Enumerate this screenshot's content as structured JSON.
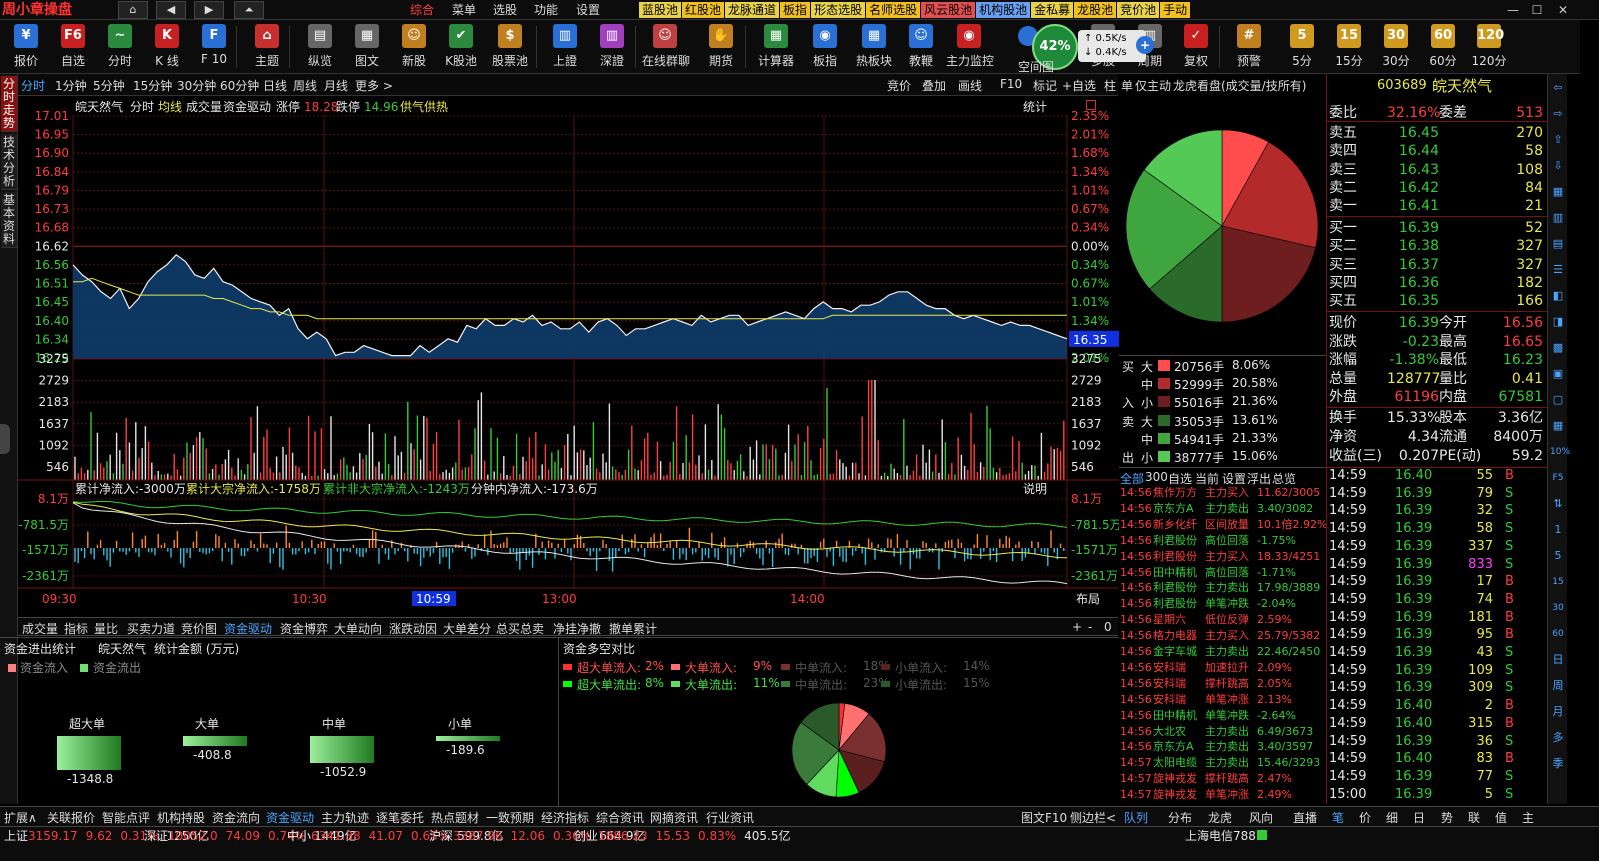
{
  "app": {
    "logo": "周小章操盘"
  },
  "nav": {
    "home": "⌂",
    "back": "◀",
    "fwd": "▶",
    "up": "⏶"
  },
  "menu": [
    {
      "label": "综合",
      "active": true
    },
    {
      "label": "菜单"
    },
    {
      "label": "选股"
    },
    {
      "label": "功能"
    },
    {
      "label": "设置"
    }
  ],
  "pools": [
    {
      "label": "蓝股池",
      "bg": "#e8d24a"
    },
    {
      "label": "红股池",
      "bg": "#f0c020"
    },
    {
      "label": "龙脉通道",
      "bg": "#e8d24a"
    },
    {
      "label": "板指",
      "bg": "#f0c020"
    },
    {
      "label": "形态选股",
      "bg": "#e8d24a"
    },
    {
      "label": "名师选股",
      "bg": "#f0c020"
    },
    {
      "label": "风云股池",
      "bg": "#e05050"
    },
    {
      "label": "机构股池",
      "bg": "#6aa0f0"
    },
    {
      "label": "金私募",
      "bg": "#e8d24a"
    },
    {
      "label": "龙股池",
      "bg": "#f0c020"
    },
    {
      "label": "竞价池",
      "bg": "#e8d24a"
    },
    {
      "label": "手动",
      "bg": "#f0c020"
    }
  ],
  "toolbar": [
    {
      "label": "报价",
      "icon": "¥",
      "color": "#2a6fd6"
    },
    {
      "label": "自选",
      "icon": "F6",
      "color": "#c82020"
    },
    {
      "label": "分时",
      "icon": "~",
      "color": "#2b8a3e"
    },
    {
      "label": "K 线",
      "icon": "K",
      "color": "#c82020"
    },
    {
      "label": "F 10",
      "icon": "F",
      "color": "#2a6fd6"
    },
    {
      "label": "主题",
      "icon": "⌂",
      "color": "#c83030"
    },
    {
      "label": "纵览",
      "icon": "▤",
      "color": "#666"
    },
    {
      "label": "图文",
      "icon": "▦",
      "color": "#666"
    },
    {
      "label": "新股",
      "icon": "☺",
      "color": "#c08020"
    },
    {
      "label": "K股池",
      "icon": "✔",
      "color": "#2b8a3e"
    },
    {
      "label": "股票池",
      "icon": "$",
      "color": "#c08020"
    },
    {
      "label": "上證",
      "icon": "▥",
      "color": "#2a6fd6"
    },
    {
      "label": "深證",
      "icon": "▥",
      "color": "#a040c0"
    },
    {
      "label": "在线群聊",
      "icon": "☺",
      "color": "#c04040"
    },
    {
      "label": "期货",
      "icon": "✋",
      "color": "#c08020"
    },
    {
      "label": "计算器",
      "icon": "▦",
      "color": "#2b8a3e"
    },
    {
      "label": "板指",
      "icon": "◉",
      "color": "#2a6fd6"
    },
    {
      "label": "热板块",
      "icon": "▦",
      "color": "#2a6fd6"
    },
    {
      "label": "教鞭",
      "icon": "☺",
      "color": "#2a6fd6"
    },
    {
      "label": "主力监控",
      "icon": "◉",
      "color": "#c82020"
    },
    {
      "label": "空间图",
      "icon": "◌",
      "color": "#2a6fd6"
    },
    {
      "label": "多股",
      "icon": "▦",
      "color": "#666"
    },
    {
      "label": "周期",
      "icon": "▥",
      "color": "#666"
    },
    {
      "label": "复权",
      "icon": "✓",
      "color": "#c82020"
    },
    {
      "label": "预警",
      "icon": "#",
      "color": "#c08020"
    },
    {
      "label": "5分",
      "icon": "5",
      "color": "#d09a20"
    },
    {
      "label": "15分",
      "icon": "15",
      "color": "#d09a20"
    },
    {
      "label": "30分",
      "icon": "30",
      "color": "#d09a20"
    },
    {
      "label": "60分",
      "icon": "60",
      "color": "#d09a20"
    },
    {
      "label": "120分",
      "icon": "120",
      "color": "#d09a20"
    }
  ],
  "speed": {
    "pct": "42%",
    "up": "0.5K/s",
    "down": "0.4K/s"
  },
  "leftTabs": [
    {
      "label": "分时走势",
      "on": true
    },
    {
      "label": "技术分析"
    },
    {
      "label": "基本资料"
    }
  ],
  "periodTabs": [
    "分时",
    "1分钟",
    "5分钟",
    "15分钟",
    "30分钟",
    "60分钟",
    "日线",
    "周线",
    "月线",
    "更多 >"
  ],
  "rightTabs": [
    "竞价",
    "叠加",
    "画线",
    "F10",
    "标记",
    "+自选",
    "柱",
    "单",
    "仅主动",
    "龙虎看盘(成交量/技所有)"
  ],
  "chartHeader": {
    "stock": "皖天然气",
    "mode": "分时",
    "avg": "均线",
    "vol": "成交量",
    "fund": "资金驱动",
    "limitUpLbl": "涨停",
    "limitUp": "18.28",
    "limitDnLbl": "跌停",
    "limitDn": "14.96",
    "supply": "供气供热",
    "stat": "统计"
  },
  "lowerHeader": {
    "a": "累计净流入:-3000万",
    "b": "累计大宗净流入:-1758万",
    "c": "累计非大宗净流入:-1243万",
    "d": "分钟内净流入:-173.6万",
    "help": "说明"
  },
  "chart_data": {
    "type": "line",
    "price": {
      "yTicks": [
        "17.01",
        "16.95",
        "16.90",
        "16.84",
        "16.79",
        "16.73",
        "16.68",
        "16.62",
        "16.56",
        "16.51",
        "16.45",
        "16.40",
        "16.34",
        "16.29"
      ],
      "pctTicks": [
        "2.35%",
        "2.01%",
        "1.68%",
        "1.34%",
        "1.01%",
        "0.67%",
        "0.34%",
        "0.00%",
        "0.34%",
        "0.67%",
        "1.01%",
        "1.34%",
        "1.68%",
        "2.01%"
      ],
      "last": "16.35",
      "values": [
        16.57,
        16.54,
        16.52,
        16.49,
        16.47,
        16.5,
        16.44,
        16.47,
        16.52,
        16.55,
        16.57,
        16.6,
        16.58,
        16.54,
        16.53,
        16.56,
        16.52,
        16.51,
        16.49,
        16.47,
        16.46,
        16.45,
        16.42,
        16.44,
        16.38,
        16.35,
        16.37,
        16.35,
        16.3,
        16.31,
        16.31,
        16.33,
        16.32,
        16.31,
        16.3,
        16.3,
        16.3,
        16.33,
        16.31,
        16.33,
        16.35,
        16.34,
        16.39,
        16.38,
        16.41,
        16.39,
        16.39,
        16.41,
        16.4,
        16.42,
        16.39,
        16.4,
        16.38,
        16.38,
        16.4,
        16.37,
        16.4,
        16.41,
        16.39,
        16.36,
        16.38,
        16.38,
        16.39,
        16.4,
        16.41,
        16.4,
        16.39,
        16.42,
        16.4,
        16.41,
        16.42,
        16.42,
        16.39,
        16.4,
        16.41,
        16.42,
        16.43,
        16.42,
        16.41,
        16.44,
        16.46,
        16.44,
        16.44,
        16.43,
        16.45,
        16.45,
        16.46,
        16.48,
        16.49,
        16.49,
        16.47,
        16.45,
        16.44,
        16.44,
        16.42,
        16.41,
        16.42,
        16.41,
        16.4,
        16.39,
        16.4,
        16.39,
        16.39,
        16.38,
        16.37,
        16.36,
        16.35
      ],
      "avg": [
        16.52,
        16.52,
        16.53,
        16.52,
        16.51,
        16.5,
        16.49,
        16.48,
        16.48,
        16.48,
        16.48,
        16.48,
        16.48,
        16.48,
        16.48,
        16.47,
        16.47,
        16.46,
        16.45,
        16.44,
        16.44,
        16.43,
        16.43,
        16.42,
        16.42,
        16.42,
        16.41,
        16.41,
        16.41,
        16.41,
        16.41,
        16.41,
        16.41,
        16.41,
        16.41,
        16.41,
        16.41,
        16.41,
        16.41,
        16.41,
        16.41,
        16.41,
        16.41,
        16.41,
        16.41,
        16.41,
        16.41,
        16.41,
        16.41,
        16.41,
        16.41,
        16.41,
        16.41,
        16.41,
        16.41,
        16.41,
        16.41,
        16.41,
        16.41,
        16.41,
        16.41,
        16.41,
        16.41,
        16.41,
        16.41,
        16.41,
        16.41,
        16.41,
        16.41,
        16.41,
        16.41,
        16.41,
        16.41,
        16.41,
        16.41,
        16.41,
        16.41,
        16.41,
        16.41,
        16.41,
        16.41,
        16.42,
        16.42,
        16.42,
        16.42,
        16.42,
        16.42,
        16.42,
        16.42,
        16.42,
        16.42,
        16.42,
        16.42,
        16.42,
        16.42,
        16.42,
        16.42,
        16.42,
        16.42,
        16.42,
        16.42,
        16.42,
        16.42,
        16.42,
        16.42,
        16.42,
        16.42
      ]
    },
    "volume": {
      "yTicks": [
        "3275",
        "2729",
        "2183",
        "1637",
        "1092",
        "546"
      ]
    },
    "flow": {
      "yTicks": [
        "8.1万",
        "-781.5万",
        "-1571万",
        "-2361万"
      ]
    },
    "timeAxis": [
      "09:30",
      "10:30",
      "10:59",
      "13:00",
      "14:00"
    ]
  },
  "subTabs": [
    "成交量",
    "指标",
    "量比",
    "买卖力道",
    "竞价图",
    "资金驱动",
    "资金博弈",
    "大单动向",
    "涨跌动因",
    "大单差分",
    "总买总卖",
    "净挂净撤",
    "撤单累计"
  ],
  "subTabsActive": "资金驱动",
  "layoutBtn": "布局",
  "panelA": {
    "title": "资金进出统计",
    "stock": "皖天然气",
    "unit": "统计金额 (万元)",
    "inLbl": "资金流入",
    "outLbl": "资金流出",
    "bars": [
      {
        "name": "超大单",
        "value": "-1348.8",
        "fill": 1.0
      },
      {
        "name": "大单",
        "value": "-408.8",
        "fill": 0.3
      },
      {
        "name": "中单",
        "value": "-1052.9",
        "fill": 0.78
      },
      {
        "name": "小单",
        "value": "-189.6",
        "fill": 0.14
      }
    ]
  },
  "panelB": {
    "title": "资金多空对比",
    "legend": [
      {
        "label": "超大单流入:",
        "value": "2%",
        "color": "#ff3030"
      },
      {
        "label": "大单流入:",
        "value": "9%",
        "color": "#ff7070"
      },
      {
        "label": "中单流入:",
        "value": "18%",
        "color": "#7a3030"
      },
      {
        "label": "小单流入:",
        "value": "14%",
        "color": "#5a2020"
      },
      {
        "label": "超大单流出:",
        "value": "8%",
        "color": "#00ff00"
      },
      {
        "label": "大单流出:",
        "value": "11%",
        "color": "#5fdc5f"
      },
      {
        "label": "中单流出:",
        "value": "23%",
        "color": "#3a7a3a"
      },
      {
        "label": "小单流出:",
        "value": "15%",
        "color": "#2a5a2a"
      }
    ]
  },
  "bigPie": {
    "fractions": [
      0.0806,
      0.2058,
      0.2136,
      0.1361,
      0.2133,
      0.1506
    ],
    "colors": [
      "#ff4d4d",
      "#b22a2a",
      "#6e1e1e",
      "#2a6a2a",
      "#3fa63f",
      "#55c955"
    ]
  },
  "orderStats": [
    {
      "side": "买",
      "size": "大",
      "hand": "20756手",
      "pct": "8.06%",
      "color": "#ff4d4d"
    },
    {
      "side": "",
      "size": "中",
      "hand": "52999手",
      "pct": "20.58%",
      "color": "#b22a2a"
    },
    {
      "side": "入",
      "size": "小",
      "hand": "55016手",
      "pct": "21.36%",
      "color": "#6e1e1e"
    },
    {
      "side": "卖",
      "size": "大",
      "hand": "35053手",
      "pct": "13.61%",
      "color": "#2a6a2a"
    },
    {
      "side": "",
      "size": "中",
      "hand": "54941手",
      "pct": "21.33%",
      "color": "#3fa63f"
    },
    {
      "side": "出",
      "size": "小",
      "hand": "38777手",
      "pct": "15.06%",
      "color": "#55c955"
    }
  ],
  "tickerTabs": [
    "全部",
    "300",
    "自选",
    "当前",
    "设置",
    "浮出",
    "总览"
  ],
  "ticker": [
    {
      "t": "14:56",
      "n": "焦作万方",
      "e": "主力买入",
      "v": "11.62/3005",
      "c": "r"
    },
    {
      "t": "14:56",
      "n": "京东方A",
      "e": "主力卖出",
      "v": "3.40/3082",
      "c": "g"
    },
    {
      "t": "14:56",
      "n": "新乡化纤",
      "e": "区间放量",
      "v": "10.1倍2.92%",
      "c": "r"
    },
    {
      "t": "14:56",
      "n": "利君股份",
      "e": "高位回落",
      "v": "-1.75%",
      "c": "g"
    },
    {
      "t": "14:56",
      "n": "利君股份",
      "e": "主力买入",
      "v": "18.33/4251",
      "c": "r"
    },
    {
      "t": "14:56",
      "n": "田中精机",
      "e": "高位回落",
      "v": "-1.71%",
      "c": "g"
    },
    {
      "t": "14:56",
      "n": "利君股份",
      "e": "主力卖出",
      "v": "17.98/3889",
      "c": "g"
    },
    {
      "t": "14:56",
      "n": "利君股份",
      "e": "单笔冲跌",
      "v": "-2.04%",
      "c": "g"
    },
    {
      "t": "14:56",
      "n": "星期六",
      "e": "低位反弹",
      "v": "2.59%",
      "c": "r"
    },
    {
      "t": "14:56",
      "n": "格力电器",
      "e": "主力买入",
      "v": "25.79/5382",
      "c": "r"
    },
    {
      "t": "14:56",
      "n": "金字车城",
      "e": "主力卖出",
      "v": "22.46/2450",
      "c": "g"
    },
    {
      "t": "14:56",
      "n": "安科瑞",
      "e": "加速拉升",
      "v": "2.09%",
      "c": "r"
    },
    {
      "t": "14:56",
      "n": "安科瑞",
      "e": "撑杆跳高",
      "v": "2.05%",
      "c": "r"
    },
    {
      "t": "14:56",
      "n": "安科瑞",
      "e": "单笔冲涨",
      "v": "2.13%",
      "c": "r"
    },
    {
      "t": "14:56",
      "n": "田中精机",
      "e": "单笔冲跌",
      "v": "-2.64%",
      "c": "g"
    },
    {
      "t": "14:56",
      "n": "大北农",
      "e": "主力卖出",
      "v": "6.49/3673",
      "c": "g"
    },
    {
      "t": "14:56",
      "n": "京东方A",
      "e": "主力卖出",
      "v": "3.40/3597",
      "c": "g"
    },
    {
      "t": "14:57",
      "n": "太阳电缆",
      "e": "主力卖出",
      "v": "15.46/3293",
      "c": "g"
    },
    {
      "t": "14:57",
      "n": "旋神戎发",
      "e": "撑杆跳高",
      "v": "2.47%",
      "c": "r"
    },
    {
      "t": "14:57",
      "n": "旋神戎发",
      "e": "单笔冲涨",
      "v": "2.49%",
      "c": "r"
    }
  ],
  "quote": {
    "code": "603689",
    "name": "皖天然气",
    "weibi": {
      "l1": "委比",
      "v1": "32.16%",
      "l2": "委差",
      "v2": "513"
    },
    "asks": [
      {
        "l": "卖五",
        "p": "16.45",
        "v": "270"
      },
      {
        "l": "卖四",
        "p": "16.44",
        "v": "58"
      },
      {
        "l": "卖三",
        "p": "16.43",
        "v": "108"
      },
      {
        "l": "卖二",
        "p": "16.42",
        "v": "84"
      },
      {
        "l": "卖一",
        "p": "16.41",
        "v": "21"
      }
    ],
    "bids": [
      {
        "l": "买一",
        "p": "16.39",
        "v": "52"
      },
      {
        "l": "买二",
        "p": "16.38",
        "v": "327"
      },
      {
        "l": "买三",
        "p": "16.37",
        "v": "327"
      },
      {
        "l": "买四",
        "p": "16.36",
        "v": "182"
      },
      {
        "l": "买五",
        "p": "16.35",
        "v": "166"
      }
    ],
    "stats": [
      {
        "l1": "现价",
        "v1": "16.39",
        "c1": "g",
        "l2": "今开",
        "v2": "16.56",
        "c2": "r"
      },
      {
        "l1": "涨跌",
        "v1": "-0.23",
        "c1": "g",
        "l2": "最高",
        "v2": "16.65",
        "c2": "r"
      },
      {
        "l1": "涨幅",
        "v1": "-1.38%",
        "c1": "g",
        "l2": "最低",
        "v2": "16.23",
        "c2": "g"
      },
      {
        "l1": "总量",
        "v1": "128777",
        "c1": "y",
        "l2": "量比",
        "v2": "0.41",
        "c2": "y"
      },
      {
        "l1": "外盘",
        "v1": "61196",
        "c1": "r",
        "l2": "内盘",
        "v2": "67581",
        "c2": "g"
      }
    ],
    "stats2": [
      {
        "l1": "换手",
        "v1": "15.33%",
        "l2": "股本",
        "v2": "3.36亿"
      },
      {
        "l1": "净资",
        "v1": "4.34",
        "l2": "流通",
        "v2": "8400万"
      },
      {
        "l1": "收益(三)",
        "v1": "0.207",
        "l2": "PE(动)",
        "v2": "59.2"
      }
    ],
    "trades": [
      {
        "t": "14:59",
        "p": "16.40",
        "v": "55",
        "s": "B",
        "vc": "y"
      },
      {
        "t": "14:59",
        "p": "16.39",
        "v": "79",
        "s": "S",
        "vc": "y"
      },
      {
        "t": "14:59",
        "p": "16.39",
        "v": "32",
        "s": "S",
        "vc": "y"
      },
      {
        "t": "14:59",
        "p": "16.39",
        "v": "58",
        "s": "S",
        "vc": "y"
      },
      {
        "t": "14:59",
        "p": "16.39",
        "v": "337",
        "s": "S",
        "vc": "y"
      },
      {
        "t": "14:59",
        "p": "16.39",
        "v": "833",
        "s": "S",
        "vc": "m"
      },
      {
        "t": "14:59",
        "p": "16.39",
        "v": "17",
        "s": "B",
        "vc": "y"
      },
      {
        "t": "14:59",
        "p": "16.39",
        "v": "74",
        "s": "B",
        "vc": "y"
      },
      {
        "t": "14:59",
        "p": "16.39",
        "v": "181",
        "s": "B",
        "vc": "y"
      },
      {
        "t": "14:59",
        "p": "16.39",
        "v": "95",
        "s": "B",
        "vc": "y"
      },
      {
        "t": "14:59",
        "p": "16.39",
        "v": "43",
        "s": "S",
        "vc": "y"
      },
      {
        "t": "14:59",
        "p": "16.39",
        "v": "109",
        "s": "S",
        "vc": "y"
      },
      {
        "t": "14:59",
        "p": "16.39",
        "v": "309",
        "s": "S",
        "vc": "y"
      },
      {
        "t": "14:59",
        "p": "16.40",
        "v": "2",
        "s": "B",
        "vc": "y"
      },
      {
        "t": "14:59",
        "p": "16.40",
        "v": "315",
        "s": "B",
        "vc": "y"
      },
      {
        "t": "14:59",
        "p": "16.39",
        "v": "36",
        "s": "S",
        "vc": "y"
      },
      {
        "t": "14:59",
        "p": "16.40",
        "v": "83",
        "s": "B",
        "vc": "y"
      },
      {
        "t": "14:59",
        "p": "16.39",
        "v": "77",
        "s": "S",
        "vc": "y"
      },
      {
        "t": "15:00",
        "p": "16.39",
        "v": "5",
        "s": "S",
        "vc": "y"
      }
    ],
    "tabs": [
      "笔",
      "价",
      "细",
      "日",
      "势",
      "联",
      "值",
      "主"
    ]
  },
  "rightIcons": [
    "⇦",
    "⇨",
    "⇧",
    "⇩",
    "▦",
    "▥",
    "▤",
    "☰",
    "◧",
    "◨",
    "▩",
    "▣",
    "▢",
    "▦",
    "10%",
    "F5",
    "⇅",
    "1",
    "5",
    "15",
    "30",
    "60",
    "日",
    "周",
    "月",
    "多",
    "季"
  ],
  "bottomNav": [
    "扩展∧",
    "关联报价",
    "智能点评",
    "机构持股",
    "资金流向",
    "资金驱动",
    "主力轨迹",
    "逐笔委托",
    "热点题材",
    "一致预期",
    "经济指标",
    "综合资讯",
    "网摘资讯",
    "行业资讯"
  ],
  "bottomNavRight": [
    "图文F10",
    "侧边栏<",
    "队列",
    "分布",
    "龙虎",
    "风向",
    "直播"
  ],
  "statusbar": [
    {
      "n": "上证",
      "v": "3159.17",
      "c": "9.62",
      "p": "0.31%",
      "a": "1250亿",
      "col": "r"
    },
    {
      "n": "深证",
      "v": "10052.0",
      "c": "74.09",
      "p": "0.74%",
      "a": "1449亿",
      "col": "r"
    },
    {
      "n": "中小",
      "v": "6341.38",
      "c": "41.07",
      "p": "0.65%",
      "a": "599.8亿",
      "col": "r"
    },
    {
      "n": "沪深",
      "v": "3387.96",
      "c": "12.06",
      "p": "0.36%",
      "a": "664.9亿",
      "col": "r"
    },
    {
      "n": "创业",
      "v": "1886.23",
      "c": "15.53",
      "p": "0.83%",
      "a": "405.5亿",
      "col": "r"
    }
  ],
  "server": "上海电信788"
}
